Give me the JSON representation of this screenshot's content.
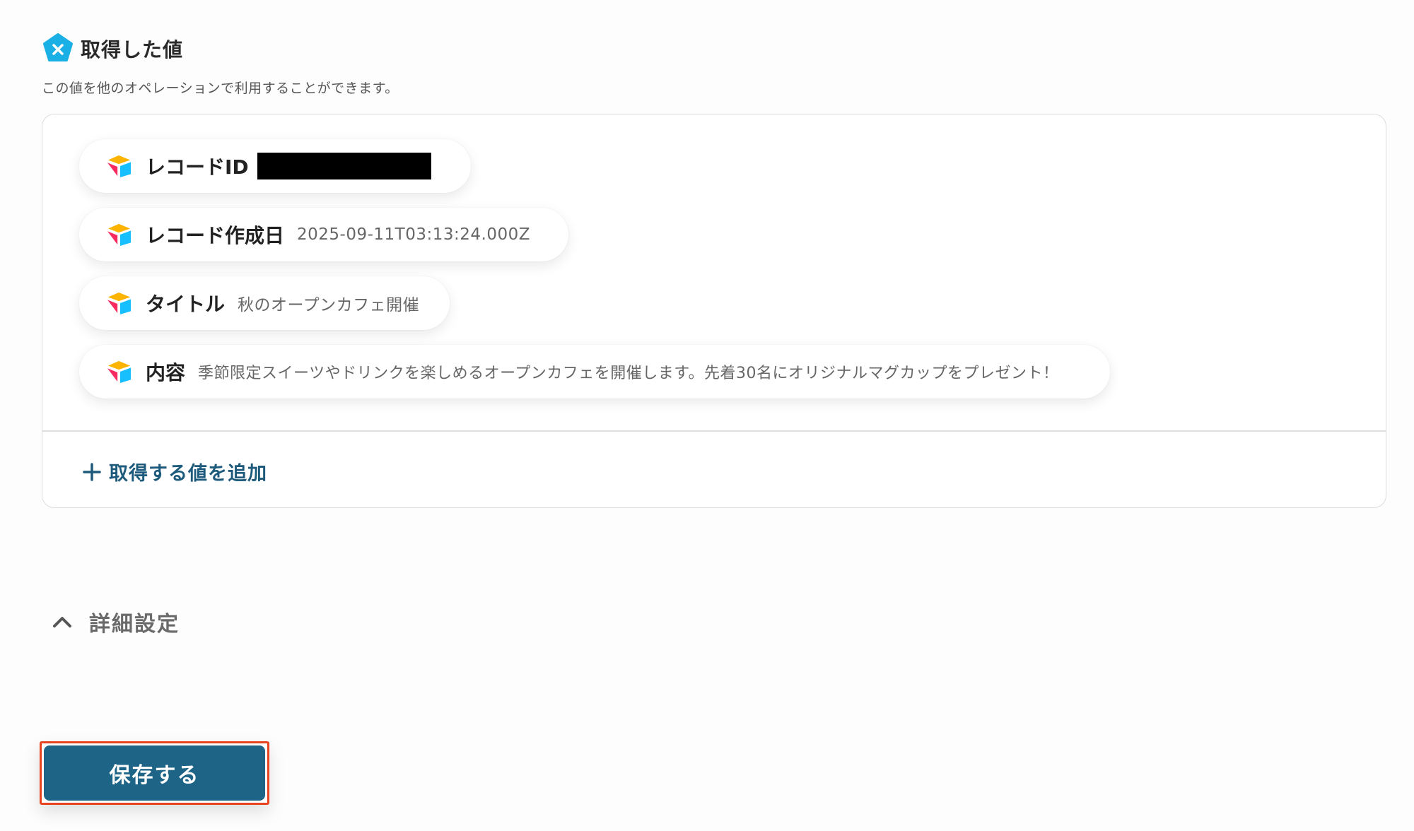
{
  "section": {
    "title": "取得した値",
    "description": "この値を他のオペレーションで利用することができます。",
    "header_icon": "x-variable-icon",
    "accent_color": "#1ab0e6"
  },
  "values": [
    {
      "label": "レコードID",
      "value": "",
      "redacted": true,
      "icon": "airtable-icon"
    },
    {
      "label": "レコード作成日",
      "value": "2025-09-11T03:13:24.000Z",
      "icon": "airtable-icon"
    },
    {
      "label": "タイトル",
      "value": "秋のオープンカフェ開催",
      "icon": "airtable-icon"
    },
    {
      "label": "内容",
      "value": "季節限定スイーツやドリンクを楽しめるオープンカフェを開催します。先着30名にオリジナルマグカップをプレゼント！",
      "icon": "airtable-icon"
    }
  ],
  "add_value": {
    "label": "取得する値を追加",
    "icon": "plus-icon",
    "color": "#1d5a7c"
  },
  "details": {
    "label": "詳細設定",
    "icon": "chevron-up-icon",
    "expanded": true
  },
  "save": {
    "label": "保存する",
    "color": "#1d6486",
    "highlight_color": "#e8431f"
  }
}
